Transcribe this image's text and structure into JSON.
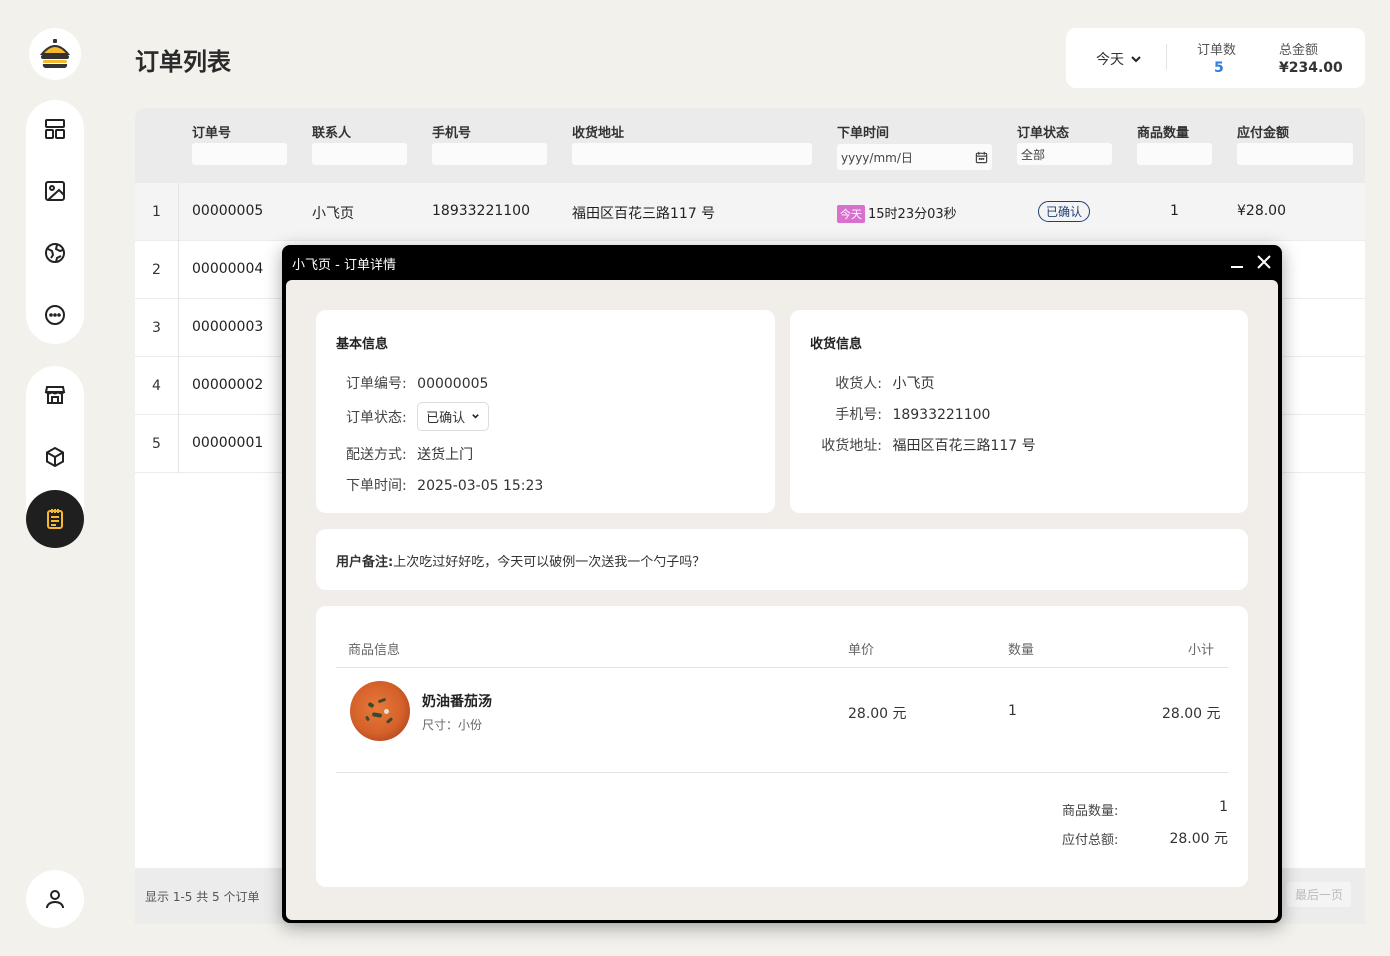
{
  "page": {
    "title": "订单列表"
  },
  "summary": {
    "range": "今天",
    "order_count_label": "订单数",
    "order_count": "5",
    "total_amount_label": "总金额",
    "total_amount": "¥234.00"
  },
  "table": {
    "headers": [
      "订单号",
      "联系人",
      "手机号",
      "收货地址",
      "下单时间",
      "订单状态",
      "商品数量",
      "应付金额"
    ],
    "filters": {
      "date_placeholder": "yyyy/mm/日",
      "status": "全部"
    },
    "rows": [
      {
        "idx": "1",
        "order_no": "00000005",
        "contact": "小飞页",
        "phone": "18933221100",
        "address": "福田区百花三路117 号",
        "time_tag": "今天",
        "time": "15时23分03秒",
        "status": "已确认",
        "qty": "1",
        "amount": "¥28.00"
      },
      {
        "idx": "2",
        "order_no": "00000004"
      },
      {
        "idx": "3",
        "order_no": "00000003"
      },
      {
        "idx": "4",
        "order_no": "00000002"
      },
      {
        "idx": "5",
        "order_no": "00000001"
      }
    ],
    "footer_text": "显示 1-5 共 5 个订单",
    "last_page": "最后一页"
  },
  "modal": {
    "title": "小飞页 - 订单详情",
    "basic": {
      "title": "基本信息",
      "order_no_label": "订单编号:",
      "order_no": "00000005",
      "status_label": "订单状态:",
      "status": "已确认",
      "delivery_label": "配送方式:",
      "delivery": "送货上门",
      "time_label": "下单时间:",
      "time": "2025-03-05 15:23"
    },
    "shipping": {
      "title": "收货信息",
      "receiver_label": "收货人:",
      "receiver": "小飞页",
      "phone_label": "手机号:",
      "phone": "18933221100",
      "address_label": "收货地址:",
      "address": "福田区百花三路117 号"
    },
    "note": {
      "label": "用户备注:",
      "text": "上次吃过好好吃，今天可以破例一次送我一个勺子吗？"
    },
    "goods": {
      "headers": {
        "info": "商品信息",
        "price": "单价",
        "qty": "数量",
        "subtotal": "小计"
      },
      "items": [
        {
          "name": "奶油番茄汤",
          "spec": "尺寸：小份",
          "price": "28.00 元",
          "qty": "1",
          "subtotal": "28.00 元"
        }
      ],
      "count_label": "商品数量:",
      "count": "1",
      "total_label": "应付总额:",
      "total": "28.00 元"
    }
  },
  "colors": {
    "accent": "#2f7be0",
    "active_nav": "#1f1f1f",
    "icon_accent": "#f5b82e",
    "today_tag": "#d96fcf",
    "status_blue": "#1f3f77"
  },
  "icons": [
    "burger-logo-icon",
    "dashboard-icon",
    "image-icon",
    "globe-icon",
    "more-icon",
    "store-icon",
    "box-icon",
    "orders-icon",
    "user-icon",
    "calendar-icon",
    "chevron-down-icon",
    "minimize-icon",
    "close-icon"
  ]
}
